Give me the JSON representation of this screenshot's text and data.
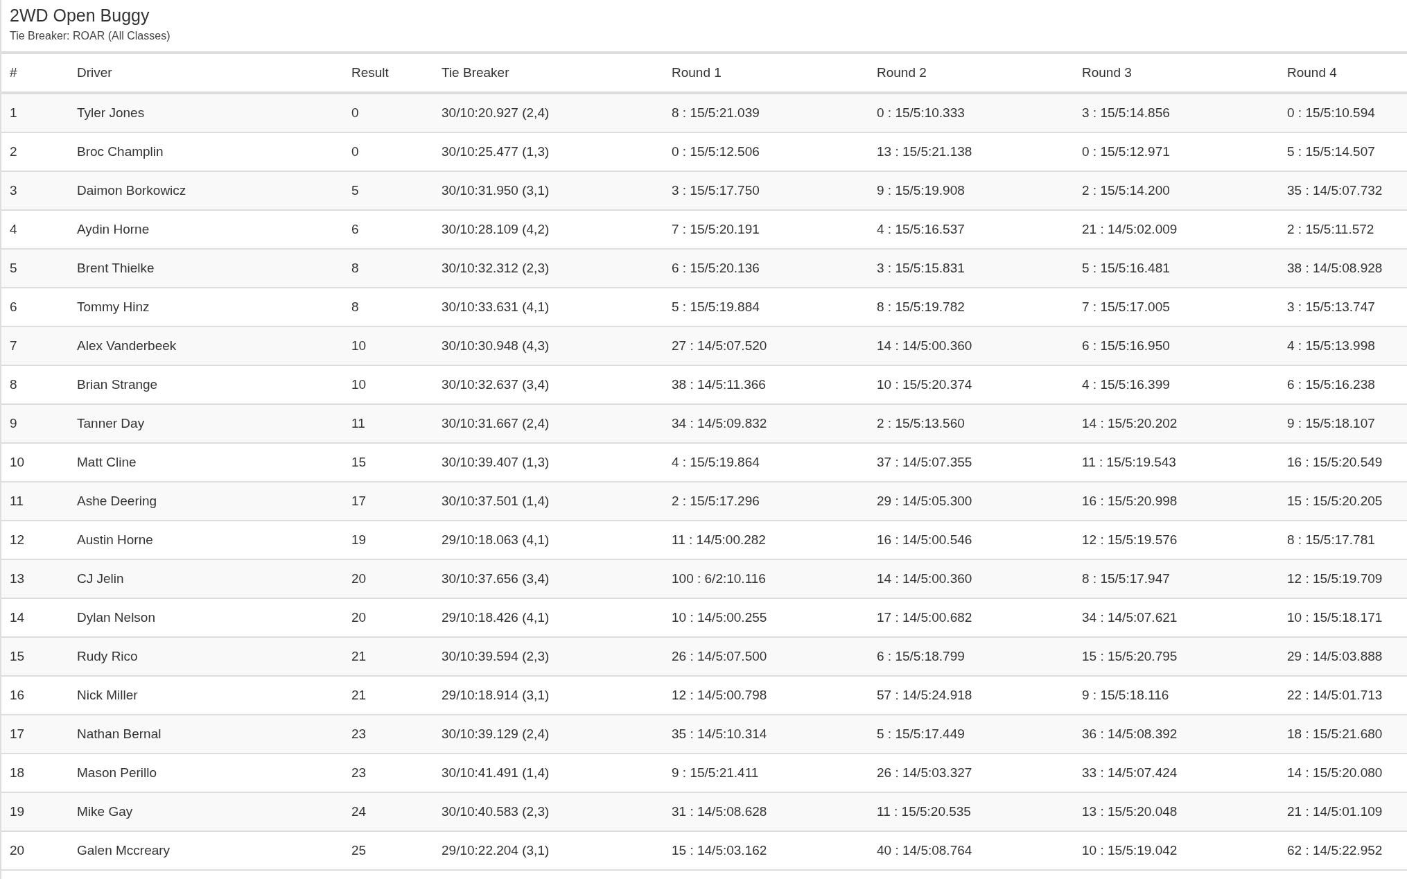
{
  "title": "2WD Open Buggy",
  "subtitle": "Tie Breaker: ROAR (All Classes)",
  "table": {
    "columns": [
      "#",
      "Driver",
      "Result",
      "Tie Breaker",
      "Round 1",
      "Round 2",
      "Round 3",
      "Round 4"
    ],
    "rows": [
      [
        "1",
        "Tyler Jones",
        "0",
        "30/10:20.927 (2,4)",
        "8 : 15/5:21.039",
        "0 : 15/5:10.333",
        "3 : 15/5:14.856",
        "0 : 15/5:10.594"
      ],
      [
        "2",
        "Broc Champlin",
        "0",
        "30/10:25.477 (1,3)",
        "0 : 15/5:12.506",
        "13 : 15/5:21.138",
        "0 : 15/5:12.971",
        "5 : 15/5:14.507"
      ],
      [
        "3",
        "Daimon Borkowicz",
        "5",
        "30/10:31.950 (3,1)",
        "3 : 15/5:17.750",
        "9 : 15/5:19.908",
        "2 : 15/5:14.200",
        "35 : 14/5:07.732"
      ],
      [
        "4",
        "Aydin Horne",
        "6",
        "30/10:28.109 (4,2)",
        "7 : 15/5:20.191",
        "4 : 15/5:16.537",
        "21 : 14/5:02.009",
        "2 : 15/5:11.572"
      ],
      [
        "5",
        "Brent Thielke",
        "8",
        "30/10:32.312 (2,3)",
        "6 : 15/5:20.136",
        "3 : 15/5:15.831",
        "5 : 15/5:16.481",
        "38 : 14/5:08.928"
      ],
      [
        "6",
        "Tommy Hinz",
        "8",
        "30/10:33.631 (4,1)",
        "5 : 15/5:19.884",
        "8 : 15/5:19.782",
        "7 : 15/5:17.005",
        "3 : 15/5:13.747"
      ],
      [
        "7",
        "Alex Vanderbeek",
        "10",
        "30/10:30.948 (4,3)",
        "27 : 14/5:07.520",
        "14 : 14/5:00.360",
        "6 : 15/5:16.950",
        "4 : 15/5:13.998"
      ],
      [
        "8",
        "Brian Strange",
        "10",
        "30/10:32.637 (3,4)",
        "38 : 14/5:11.366",
        "10 : 15/5:20.374",
        "4 : 15/5:16.399",
        "6 : 15/5:16.238"
      ],
      [
        "9",
        "Tanner Day",
        "11",
        "30/10:31.667 (2,4)",
        "34 : 14/5:09.832",
        "2 : 15/5:13.560",
        "14 : 15/5:20.202",
        "9 : 15/5:18.107"
      ],
      [
        "10",
        "Matt Cline",
        "15",
        "30/10:39.407 (1,3)",
        "4 : 15/5:19.864",
        "37 : 14/5:07.355",
        "11 : 15/5:19.543",
        "16 : 15/5:20.549"
      ],
      [
        "11",
        "Ashe Deering",
        "17",
        "30/10:37.501 (1,4)",
        "2 : 15/5:17.296",
        "29 : 14/5:05.300",
        "16 : 15/5:20.998",
        "15 : 15/5:20.205"
      ],
      [
        "12",
        "Austin Horne",
        "19",
        "29/10:18.063 (4,1)",
        "11 : 14/5:00.282",
        "16 : 14/5:00.546",
        "12 : 15/5:19.576",
        "8 : 15/5:17.781"
      ],
      [
        "13",
        "CJ Jelin",
        "20",
        "30/10:37.656 (3,4)",
        "100 : 6/2:10.116",
        "14 : 14/5:00.360",
        "8 : 15/5:17.947",
        "12 : 15/5:19.709"
      ],
      [
        "14",
        "Dylan Nelson",
        "20",
        "29/10:18.426 (4,1)",
        "10 : 14/5:00.255",
        "17 : 14/5:00.682",
        "34 : 14/5:07.621",
        "10 : 15/5:18.171"
      ],
      [
        "15",
        "Rudy Rico",
        "21",
        "30/10:39.594 (2,3)",
        "26 : 14/5:07.500",
        "6 : 15/5:18.799",
        "15 : 15/5:20.795",
        "29 : 14/5:03.888"
      ],
      [
        "16",
        "Nick Miller",
        "21",
        "29/10:18.914 (3,1)",
        "12 : 14/5:00.798",
        "57 : 14/5:24.918",
        "9 : 15/5:18.116",
        "22 : 14/5:01.713"
      ],
      [
        "17",
        "Nathan Bernal",
        "23",
        "30/10:39.129 (2,4)",
        "35 : 14/5:10.314",
        "5 : 15/5:17.449",
        "36 : 14/5:08.392",
        "18 : 15/5:21.680"
      ],
      [
        "18",
        "Mason Perillo",
        "23",
        "30/10:41.491 (1,4)",
        "9 : 15/5:21.411",
        "26 : 14/5:03.327",
        "33 : 14/5:07.424",
        "14 : 15/5:20.080"
      ],
      [
        "19",
        "Mike Gay",
        "24",
        "30/10:40.583 (2,3)",
        "31 : 14/5:08.628",
        "11 : 15/5:20.535",
        "13 : 15/5:20.048",
        "21 : 14/5:01.109"
      ],
      [
        "20",
        "Galen Mccreary",
        "25",
        "29/10:22.204 (3,1)",
        "15 : 14/5:03.162",
        "40 : 14/5:08.764",
        "10 : 15/5:19.042",
        "62 : 14/5:22.952"
      ]
    ]
  }
}
